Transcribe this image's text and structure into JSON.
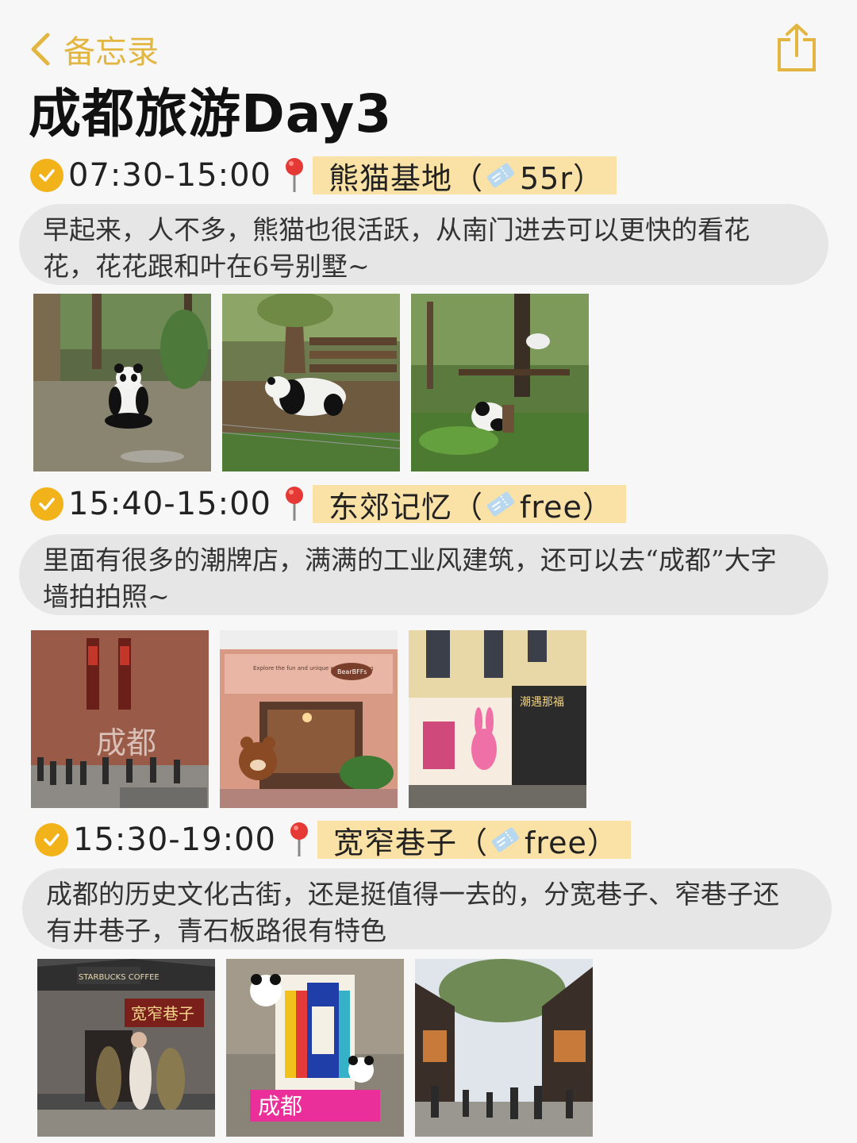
{
  "nav": {
    "back_label": "备忘录",
    "back_icon": "chevron-left-icon",
    "share_icon": "share-icon",
    "accent": "#e2b640"
  },
  "title": "成都旅游Day3",
  "sections": [
    {
      "time": "07:30-15:00",
      "place": "熊猫基地（",
      "price": "55r）",
      "note": "早起来，人不多，熊猫也很活跃，从南门进去可以更快的看花花，花花跟和叶在6号别墅~",
      "photos": [
        "panda-sitting-photo",
        "panda-walking-photo",
        "panda-eating-photo"
      ]
    },
    {
      "time": "15:40-15:00",
      "place": "东郊记忆（",
      "price": "free）",
      "note": "里面有很多的潮牌店，满满的工业风建筑，还可以去“成都”大字墙拍拍照~",
      "photos": [
        "chengdu-brick-wall-photo",
        "bear-cafe-photo",
        "pink-rabbit-shop-photo"
      ],
      "photo_text": {
        "wall_sign": "成都",
        "cafe_sign": "Explore the fun and unique world of baking",
        "cafe_brand": "BearBFFs",
        "shop_sign": "潮遇那福"
      }
    },
    {
      "time": "15:30-19:00",
      "place": "宽窄巷子（",
      "price": "free）",
      "note": "成都的历史文化古街，还是挺值得一去的，分宽巷子、窄巷子还有井巷子，青石板路很有特色",
      "photos": [
        "kuanzhai-gate-photo",
        "panda-sign-photo",
        "old-street-photo"
      ],
      "photo_text": {
        "gate_sign": "宽窄巷子",
        "coffee_sign": "STARBUCKS COFFEE",
        "installation_sign": "成都"
      }
    }
  ],
  "colors": {
    "check": "#f2b31a",
    "highlight": "#fae1a6",
    "bubble": "#e6e6e6"
  }
}
